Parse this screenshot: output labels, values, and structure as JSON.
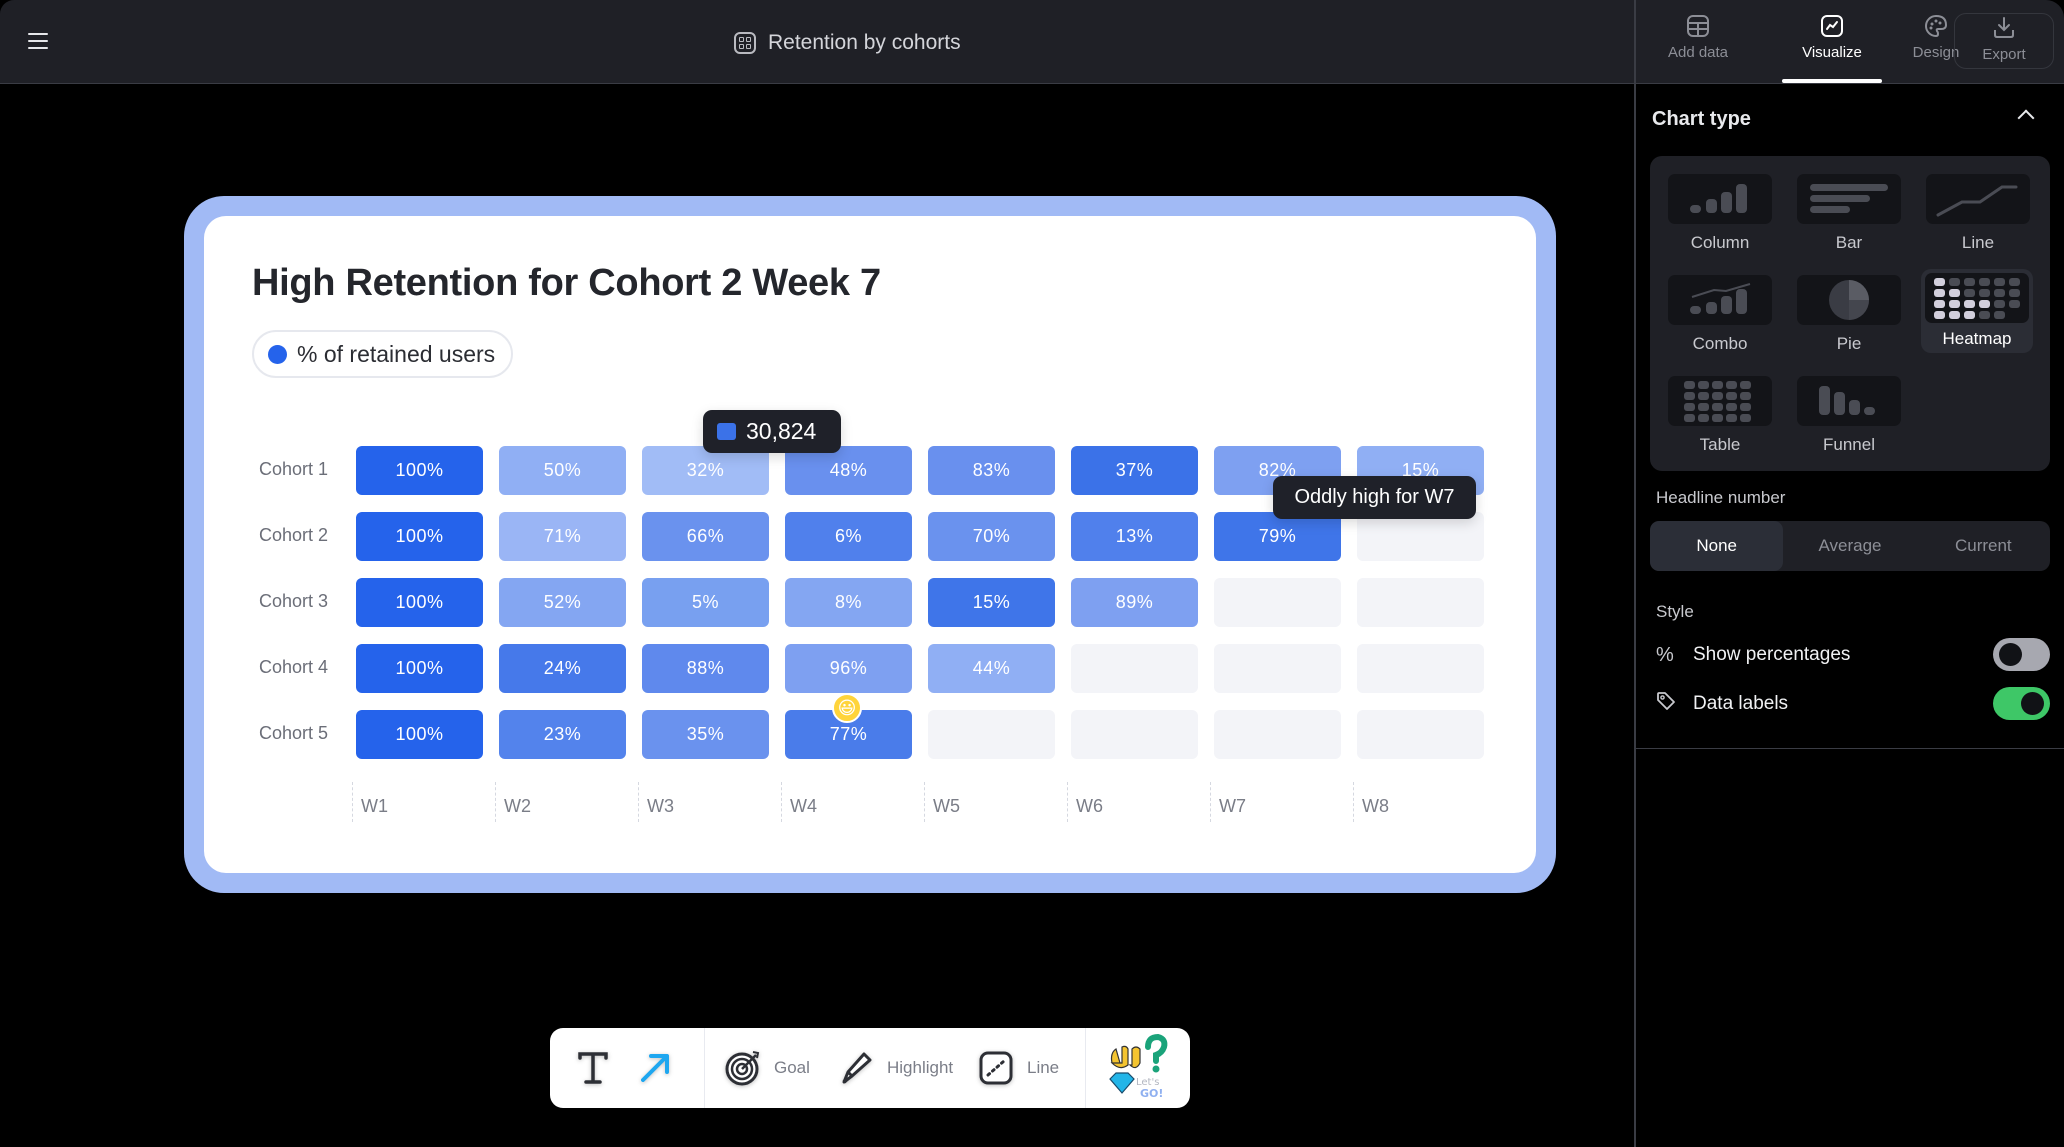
{
  "header": {
    "menu_icon": "hamburger-icon",
    "title_icon": "grid-icon",
    "title": "Retention by cohorts"
  },
  "right_tabs": [
    {
      "label": "Add data",
      "icon": "table-icon",
      "active": false
    },
    {
      "label": "Visualize",
      "icon": "chart-line-icon",
      "active": true
    },
    {
      "label": "Design",
      "icon": "palette-icon",
      "active": false
    },
    {
      "label": "Export",
      "icon": "download-icon",
      "active": false
    }
  ],
  "panel": {
    "chart_type_heading": "Chart type",
    "chart_types": [
      {
        "label": "Column",
        "selected": false
      },
      {
        "label": "Bar",
        "selected": false
      },
      {
        "label": "Line",
        "selected": false
      },
      {
        "label": "Combo",
        "selected": false
      },
      {
        "label": "Pie",
        "selected": false
      },
      {
        "label": "Heatmap",
        "selected": true
      },
      {
        "label": "Table",
        "selected": false
      },
      {
        "label": "Funnel",
        "selected": false
      }
    ],
    "headline_heading": "Headline number",
    "headline_options": [
      {
        "label": "None",
        "active": true
      },
      {
        "label": "Average",
        "active": false
      },
      {
        "label": "Current",
        "active": false
      }
    ],
    "style_heading": "Style",
    "toggles": [
      {
        "label": "Show percentages",
        "icon": "percent-icon",
        "icon_glyph": "%",
        "on": false
      },
      {
        "label": "Data labels",
        "icon": "tag-icon",
        "icon_glyph": "⬖",
        "on": true
      }
    ]
  },
  "chart_data": {
    "type": "heatmap",
    "title": "High Retention for Cohort 2 Week 7",
    "legend": [
      {
        "label": "% of retained users",
        "color": "#2563eb"
      }
    ],
    "rows": [
      "Cohort 1",
      "Cohort 2",
      "Cohort 3",
      "Cohort 4",
      "Cohort 5"
    ],
    "columns": [
      "W1",
      "W2",
      "W3",
      "W4",
      "W5",
      "W6",
      "W7",
      "W8"
    ],
    "values": [
      [
        100,
        50,
        32,
        48,
        83,
        37,
        82,
        15
      ],
      [
        100,
        71,
        66,
        6,
        70,
        13,
        79,
        null
      ],
      [
        100,
        52,
        5,
        8,
        15,
        89,
        null,
        null
      ],
      [
        100,
        24,
        88,
        96,
        44,
        null,
        null,
        null
      ],
      [
        100,
        23,
        35,
        77,
        null,
        null,
        null,
        null
      ]
    ],
    "value_suffix": "%",
    "cell_colors": [
      [
        "#2563eb",
        "#90aff4",
        "#a1bcf6",
        "#6990ee",
        "#6990ee",
        "#3b72e8",
        "#7ea0f1",
        "#90aff4"
      ],
      [
        "#2563eb",
        "#9ab5f5",
        "#6a92ee",
        "#5080ec",
        "#6a92ee",
        "#5080ec",
        "#3f75e9",
        null
      ],
      [
        "#2563eb",
        "#84a6f2",
        "#78a0f0",
        "#84a6f2",
        "#3f75e9",
        "#7ea0f1",
        null,
        null
      ],
      [
        "#2563eb",
        "#4679ea",
        "#5f89ed",
        "#7ea0f1",
        "#90aff4",
        null,
        null,
        null
      ],
      [
        "#2563eb",
        "#5383ec",
        "#6a92ee",
        "#4a7cea",
        null,
        null,
        null,
        null
      ]
    ],
    "tooltip": {
      "value": "30,824",
      "row": 0,
      "column": 3
    },
    "annotation": {
      "text": "Oddly high for W7",
      "row": 1,
      "column": 6
    },
    "sticker": {
      "emoji": "😃",
      "row": 4,
      "column": 3
    }
  },
  "toolbar": {
    "text_tool_icon": "text-icon",
    "arrow_tool_icon": "arrow-icon",
    "items": [
      {
        "label": "Goal",
        "icon": "target-icon"
      },
      {
        "label": "Highlight",
        "icon": "highlighter-icon"
      },
      {
        "label": "Line",
        "icon": "dotted-line-icon"
      }
    ],
    "sticker_text": "Let's GO!"
  }
}
